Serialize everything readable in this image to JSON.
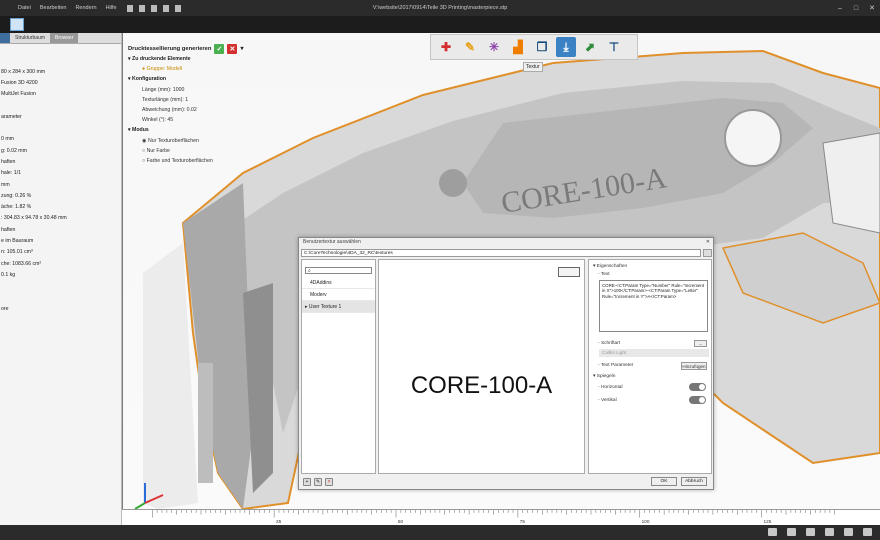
{
  "window": {
    "title": "V:\\website\\2017\\0914\\Teile 3D Printing\\masterpiece.stp",
    "menu": [
      "Datei",
      "Bearbeiten",
      "Rendern",
      "Hilfe"
    ]
  },
  "left_panel": {
    "tabs": [
      "",
      "Strukturbaum",
      "Browser"
    ],
    "lines": [
      "",
      "",
      "80 x 284 x 300 mm",
      "Fusion 3D 4200",
      "MultiJet Fusion",
      "",
      "arameter",
      "",
      "0 mm",
      "g: 0.02 mm",
      "haften",
      "hale: 1/1",
      "mm",
      "zung: 0.26 %",
      "äche: 1.82 %",
      ": 304.83 x 94.78 x 30.48 mm",
      "haften",
      "e im Bauraum",
      "n: 105.01 cm³",
      "che: 1083.66 cm²",
      "0.1 kg",
      "",
      "",
      "ore"
    ]
  },
  "tessellation": {
    "title": "Drucktessellierung generieren",
    "sections": {
      "elements": "Zu druckende Elemente",
      "group": "Gruppe: Modell",
      "config": "Konfiguration",
      "mode": "Modus"
    },
    "config_lines": [
      "Länge (mm): 1000",
      "Texturlänge (mm): 1",
      "Abweichung (mm): 0.02",
      "Winkel (°): 45"
    ],
    "modes": [
      "Nur Texturoberflächen",
      "Nur Farbe",
      "Farbe und Texturoberflächen"
    ]
  },
  "toolbar": {
    "tooltip": "Textur"
  },
  "viewport": {
    "embossed_text": "CORE-100-A"
  },
  "dialog": {
    "title": "Benutzertextur auswählen",
    "path": "C:\\CoreTechnologie\\4DA_32_RC\\textures",
    "search_placeholder": "",
    "list": [
      "4DAddins",
      "Moderv",
      "User Texture 1"
    ],
    "preview_text": "CORE-100-A",
    "props": {
      "header": "Eigenschaften",
      "text_label": "Text",
      "text_value": "CORE-<CT:Param Type=\"Number\" Rule=\"Increment in X\">100</CT:Param>-<CT:Param Type=\"Letter\" Rule=\"Increment in Y\">A</CT:Param>",
      "font_label": "Schriftart",
      "font_value": "Calibri Light",
      "params_label": "Text Parameter",
      "add_button": "Hinzufügen",
      "mirror_label": "Spiegeln",
      "horizontal": "Horizontal",
      "vertical": "Vertikal"
    },
    "ok": "OK",
    "cancel": "Abbruch"
  },
  "ruler": {
    "labels": [
      "25",
      "50",
      "75",
      "100",
      "125"
    ],
    "values": [
      25,
      50,
      75,
      100,
      125
    ]
  }
}
